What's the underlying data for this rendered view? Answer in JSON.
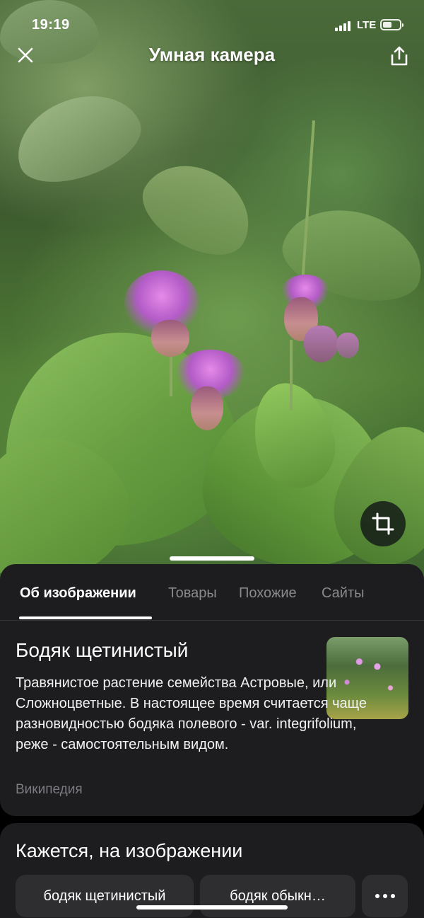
{
  "status_bar": {
    "time": "19:19",
    "network": "LTE"
  },
  "header": {
    "title": "Умная камера",
    "close_icon": "close-icon",
    "share_icon": "share-icon"
  },
  "photo": {
    "crop_icon": "crop-icon"
  },
  "tabs": [
    {
      "label": "Об изображении",
      "active": true
    },
    {
      "label": "Товары",
      "active": false
    },
    {
      "label": "Похожие",
      "active": false
    },
    {
      "label": "Сайты",
      "active": false
    }
  ],
  "info": {
    "title": "Бодяк щетинистый",
    "description": "Травянистое растение семейства Астровые, или Сложноцветные. В настоящее время считается чаще разновидностью бодяка полевого - var. integrifolium, реже - самостоятельным видом.",
    "source": "Википедия"
  },
  "suggestions": {
    "title": "Кажется, на изображении",
    "chips": [
      "бодяк щетинистый",
      "бодяк обыкн…"
    ],
    "more_icon": "more-icon"
  },
  "colors": {
    "sheet_bg": "#1d1d1f",
    "chip_bg": "#2e2e31",
    "muted_text": "#8a8a8e"
  }
}
